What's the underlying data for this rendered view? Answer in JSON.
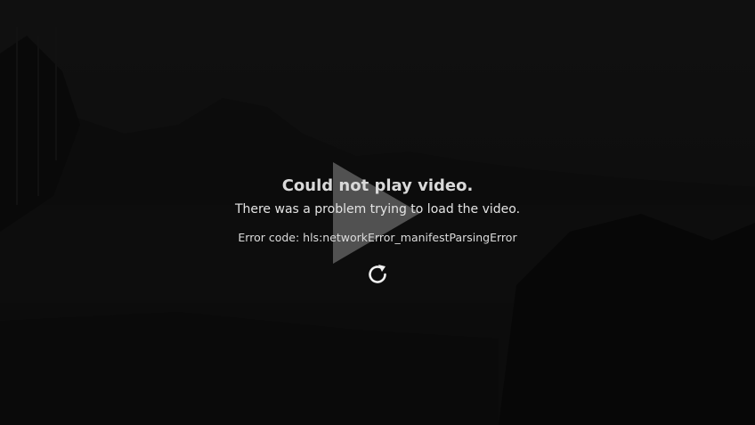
{
  "error": {
    "title": "Could not play video.",
    "message": "There was a problem trying to load the video.",
    "code": "Error code: hls:networkError_manifestParsingError"
  },
  "icons": {
    "play": "play-icon",
    "retry": "refresh-icon"
  },
  "colors": {
    "background": "#111111",
    "text": "#e4e4e4",
    "play_icon": "#8a8a8a"
  }
}
